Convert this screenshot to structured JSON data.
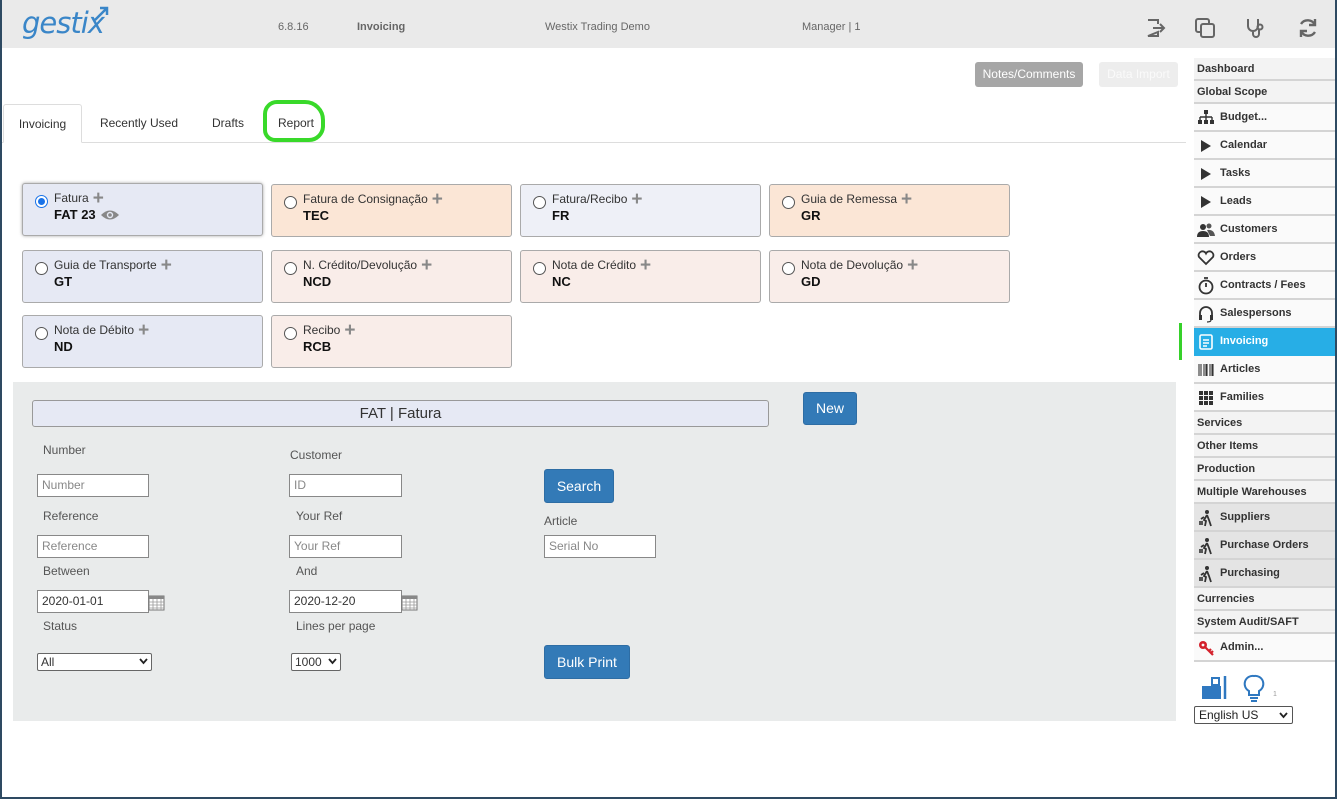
{
  "header": {
    "logo": "gestix",
    "version": "6.8.16",
    "module": "Invoicing",
    "company": "Westix Trading Demo",
    "user": "Manager | 1",
    "icons": [
      "logout-icon",
      "window-icon",
      "stethoscope-icon",
      "refresh-icon"
    ]
  },
  "top_buttons": {
    "notes": "Notes/Comments",
    "data_import": "Data Import"
  },
  "tabs": [
    {
      "label": "Invoicing",
      "active": true
    },
    {
      "label": "Recently Used",
      "active": false
    },
    {
      "label": "Drafts",
      "active": false
    },
    {
      "label": "Report",
      "active": false
    }
  ],
  "doc_types": [
    {
      "label": "Fatura",
      "code": "FAT 23",
      "selected": true,
      "style": "blue"
    },
    {
      "label": "Fatura de Consignação",
      "code": "TEC",
      "selected": false,
      "style": "orange"
    },
    {
      "label": "Fatura/Recibo",
      "code": "FR",
      "selected": false,
      "style": "pale"
    },
    {
      "label": "Guia de Remessa",
      "code": "GR",
      "selected": false,
      "style": "orange"
    },
    {
      "label": "Guia de Transporte",
      "code": "GT",
      "selected": false,
      "style": "blue"
    },
    {
      "label": "N. Crédito/Devolução",
      "code": "NCD",
      "selected": false,
      "style": "pink"
    },
    {
      "label": "Nota de Crédito",
      "code": "NC",
      "selected": false,
      "style": "pink"
    },
    {
      "label": "Nota de Devolução",
      "code": "GD",
      "selected": false,
      "style": "pink"
    },
    {
      "label": "Nota de Débito",
      "code": "ND",
      "selected": false,
      "style": "blue"
    },
    {
      "label": "Recibo",
      "code": "RCB",
      "selected": false,
      "style": "pink"
    }
  ],
  "search": {
    "title": "FAT | Fatura",
    "new_button": "New",
    "search_button": "Search",
    "bulk_print_button": "Bulk Print",
    "labels": {
      "number": "Number",
      "customer": "Customer",
      "reference": "Reference",
      "your_ref": "Your Ref",
      "article": "Article",
      "between": "Between",
      "and": "And",
      "status": "Status",
      "lines_per_page": "Lines per page"
    },
    "placeholders": {
      "number": "Number",
      "customer": "ID",
      "reference": "Reference",
      "your_ref": "Your Ref",
      "article": "Serial No"
    },
    "values": {
      "between": "2020-01-01",
      "and": "2020-12-20",
      "status": "All",
      "lines_per_page": "1000"
    }
  },
  "sidebar": {
    "items": [
      {
        "label": "Dashboard",
        "icon": ""
      },
      {
        "label": "Global Scope",
        "icon": ""
      },
      {
        "label": "Budget...",
        "icon": "org-chart-icon"
      },
      {
        "label": "Calendar",
        "icon": "play-icon"
      },
      {
        "label": "Tasks",
        "icon": "play-icon"
      },
      {
        "label": "Leads",
        "icon": "play-icon"
      },
      {
        "label": "Customers",
        "icon": "users-icon"
      },
      {
        "label": "Orders",
        "icon": "heart-icon"
      },
      {
        "label": "Contracts / Fees",
        "icon": "stopwatch-icon"
      },
      {
        "label": "Salespersons",
        "icon": "headset-icon"
      },
      {
        "label": "Invoicing",
        "icon": "document-icon",
        "active": true
      },
      {
        "label": "Articles",
        "icon": "barcode-icon"
      },
      {
        "label": "Families",
        "icon": "grid-icon"
      },
      {
        "label": "Services",
        "icon": ""
      },
      {
        "label": "Other Items",
        "icon": ""
      },
      {
        "label": "Production",
        "icon": ""
      },
      {
        "label": "Multiple Warehouses",
        "icon": ""
      },
      {
        "label": "Suppliers",
        "icon": "worker-icon"
      },
      {
        "label": "Purchase Orders",
        "icon": "worker-icon"
      },
      {
        "label": "Purchasing",
        "icon": "worker-icon"
      },
      {
        "label": "Currencies",
        "icon": ""
      },
      {
        "label": "System Audit/SAFT",
        "icon": ""
      },
      {
        "label": "Admin...",
        "icon": "key-icon"
      }
    ],
    "footer_count": "1",
    "language": "English US"
  },
  "colors": {
    "brand": "#3a86c8",
    "active_item": "#27aee6",
    "primary_button": "#337ab7",
    "highlight": "#39d92a"
  }
}
